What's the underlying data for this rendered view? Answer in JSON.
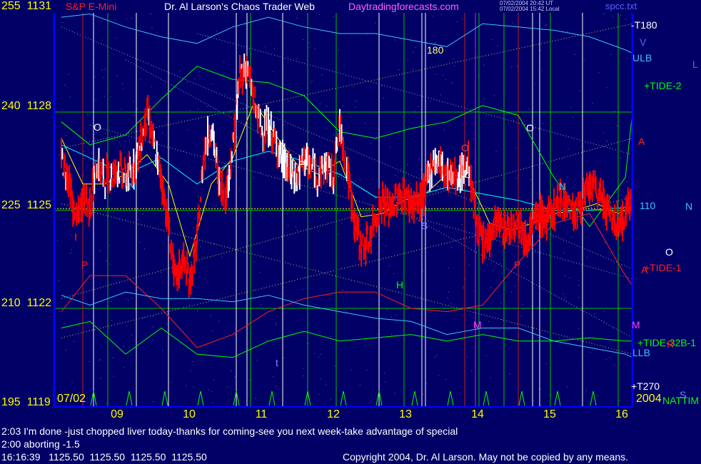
{
  "header": {
    "instrument": "S&P E-Mini",
    "title": "Dr. Al Larson's Chaos Trader Web",
    "site": "Daytradingforecasts.com",
    "timestamp_1": "07/02/2004 20:42 UT",
    "timestamp_2": "07/02/2004 15:42 Local",
    "file": "spcc.txt"
  },
  "start_date": "07/02",
  "year": "2004",
  "right_labels": {
    "t180": "-T180",
    "ulb": "ULB",
    "tide2": "+TIDE-2",
    "p110": "110",
    "tide1": "+TIDE-1",
    "tide32": "+TIDE-32B-1",
    "llb": "LLB",
    "t270": "+T270",
    "natim": "NATTIM"
  },
  "markers": {
    "o": "O",
    "n": "N",
    "p": "P",
    "s": "S",
    "h": "H",
    "m": "M",
    "t": "t",
    "a": "A",
    "v": "V",
    "l": "L",
    "r": "R",
    "deg180": "180"
  },
  "messages": [
    "2:03 I'm done -just chopped liver today-thanks for coming-see you next week-take advantage of special",
    "2:00 aborting -1.5"
  ],
  "last_quote": "16:16:39   1125.50  1125.50  1125.50  1125.50",
  "copyright": "Copyright 2004, Dr. Al Larson. May not be copied by any means.",
  "colors": {
    "background": "#000066",
    "grid_green": "#00c000",
    "axis_blue": "#0000ff",
    "bar_up": "#ffffff",
    "bar_down": "#ff0000",
    "ma_fast": "#ffff00",
    "ma_slow": "#00ffff",
    "tide_green": "#00ff00",
    "tide_red": "#ff2020",
    "band_cyan": "#40c0ff"
  },
  "chart_data": {
    "type": "line",
    "title": "S&P E-Mini",
    "xlabel": "",
    "ylabel": "",
    "y_ticks": [
      {
        "left": "255",
        "right": "1131",
        "value": 1131
      },
      {
        "left": "240",
        "right": "1128",
        "value": 1128
      },
      {
        "left": "225",
        "right": "1125",
        "value": 1125
      },
      {
        "left": "210",
        "right": "1122",
        "value": 1122
      },
      {
        "left": "195",
        "right": "1119",
        "value": 1119
      }
    ],
    "x_ticks": [
      "09",
      "10",
      "11",
      "12",
      "13",
      "14",
      "15",
      "16"
    ],
    "ylim": [
      1119,
      1131.5
    ],
    "xlim": [
      8.0,
      16.1
    ],
    "grid": true,
    "series": [
      {
        "name": "S&P E-Mini",
        "x": [
          8.1,
          8.2,
          8.3,
          8.4,
          8.5,
          8.6,
          8.7,
          8.8,
          8.9,
          9.0,
          9.1,
          9.2,
          9.3,
          9.4,
          9.5,
          9.6,
          9.7,
          9.8,
          9.9,
          10.0,
          10.1,
          10.2,
          10.3,
          10.4,
          10.5,
          10.6,
          10.7,
          10.8,
          10.9,
          11.0,
          11.1,
          11.2,
          11.3,
          11.4,
          11.5,
          11.6,
          11.7,
          11.8,
          11.9,
          12.0,
          12.1,
          12.2,
          12.3,
          12.4,
          12.5,
          12.6,
          12.7,
          12.8,
          12.9,
          13.0,
          13.1,
          13.2,
          13.3,
          13.4,
          13.5,
          13.6,
          13.7,
          13.8,
          13.9,
          14.0,
          14.1,
          14.2,
          14.3,
          14.4,
          14.5,
          14.6,
          14.7,
          14.8,
          14.9,
          15.0,
          15.1,
          15.2,
          15.3,
          15.4,
          15.5,
          15.6,
          15.7,
          15.8,
          15.9,
          16.0,
          16.1
        ],
        "values": [
          1126.6,
          1126.0,
          1124.5,
          1125.4,
          1125.1,
          1126.4,
          1126.0,
          1126.1,
          1126.3,
          1126.0,
          1126.2,
          1126.9,
          1128.0,
          1127.0,
          1126.0,
          1124.5,
          1122.8,
          1123.5,
          1122.8,
          1124.0,
          1126.8,
          1127.6,
          1126.0,
          1125.4,
          1126.9,
          1129.1,
          1129.4,
          1128.3,
          1127.5,
          1127.5,
          1127.1,
          1126.5,
          1126.1,
          1126.0,
          1126.6,
          1126.3,
          1126.1,
          1126.4,
          1126.0,
          1127.6,
          1126.3,
          1124.7,
          1123.9,
          1124.0,
          1124.8,
          1125.3,
          1125.0,
          1125.4,
          1125.5,
          1125.2,
          1125.2,
          1125.6,
          1126.5,
          1126.5,
          1126.1,
          1126.0,
          1126.1,
          1126.5,
          1124.8,
          1123.9,
          1124.2,
          1124.7,
          1124.4,
          1124.5,
          1124.8,
          1124.1,
          1124.5,
          1124.9,
          1124.7,
          1125.0,
          1125.4,
          1125.2,
          1124.9,
          1125.3,
          1125.7,
          1125.6,
          1125.3,
          1124.7,
          1124.6,
          1124.8,
          1125.5
        ]
      },
      {
        "name": "",
        "x": [
          8.1,
          8.4,
          8.7,
          9.0,
          9.3,
          9.6,
          9.9,
          10.2,
          10.5,
          10.8,
          11.1,
          11.4,
          11.7,
          12.0,
          12.3,
          12.6,
          12.9,
          13.2,
          13.5,
          13.8,
          14.1,
          14.4,
          14.7,
          15.0,
          15.3,
          15.6,
          15.9,
          16.1
        ],
        "values": [
          1127.2,
          1125.8,
          1125.8,
          1126.1,
          1126.7,
          1125.8,
          1123.6,
          1125.8,
          1126.6,
          1128.3,
          1127.3,
          1126.4,
          1126.1,
          1126.5,
          1124.8,
          1124.9,
          1125.3,
          1125.5,
          1126.1,
          1126.0,
          1124.6,
          1124.4,
          1124.6,
          1124.9,
          1125.0,
          1125.2,
          1124.9,
          1125.1
        ]
      },
      {
        "name": "",
        "x": [
          8.1,
          8.5,
          9.0,
          9.5,
          10.0,
          10.5,
          11.0,
          11.5,
          12.0,
          12.5,
          13.0,
          13.5,
          14.0,
          14.5,
          15.0,
          15.5,
          16.1
        ],
        "values": [
          1127.0,
          1126.6,
          1126.1,
          1126.6,
          1125.8,
          1126.5,
          1126.8,
          1126.5,
          1126.1,
          1125.4,
          1125.4,
          1125.7,
          1125.5,
          1125.3,
          1125.0,
          1125.0,
          1125.1
        ]
      },
      {
        "name": "+TIDE-2",
        "x": [
          8.1,
          8.5,
          9.0,
          9.5,
          10.0,
          10.5,
          11.0,
          11.5,
          12.0,
          12.5,
          13.0,
          13.5,
          14.0,
          14.5,
          15.0,
          15.5,
          16.0,
          16.1
        ],
        "values": [
          1127.7,
          1127.0,
          1127.3,
          1128.4,
          1129.4,
          1129.0,
          1128.9,
          1128.5,
          1127.4,
          1127.2,
          1127.5,
          1127.7,
          1128.2,
          1127.9,
          1126.0,
          1124.5,
          1126.0,
          1128.0
        ]
      },
      {
        "name": "+TIDE-1",
        "x": [
          8.1,
          8.5,
          9.0,
          9.5,
          10.0,
          10.5,
          11.0,
          11.5,
          12.0,
          12.5,
          13.0,
          13.5,
          14.0,
          14.5,
          15.0,
          15.5,
          16.0,
          16.1
        ],
        "values": [
          1121.9,
          1123.0,
          1123.0,
          1122.0,
          1120.8,
          1121.2,
          1121.9,
          1122.3,
          1122.5,
          1122.5,
          1122.0,
          1121.9,
          1122.1,
          1123.4,
          1124.6,
          1124.9,
          1123.0,
          1122.7
        ]
      },
      {
        "name": "ULB",
        "x": [
          8.1,
          8.5,
          9.0,
          9.5,
          10.0,
          10.5,
          11.0,
          11.5,
          12.0,
          12.5,
          13.0,
          13.5,
          14.0,
          14.5,
          15.0,
          15.5,
          16.0,
          16.1
        ],
        "values": [
          1130.9,
          1131.0,
          1130.6,
          1130.3,
          1130.1,
          1130.6,
          1130.9,
          1130.6,
          1130.4,
          1130.4,
          1130.2,
          1130.0,
          1130.7,
          1130.6,
          1130.5,
          1130.3,
          1129.9,
          1129.8
        ]
      },
      {
        "name": "LLB",
        "x": [
          8.1,
          8.5,
          9.0,
          9.5,
          10.0,
          10.5,
          11.0,
          11.5,
          12.0,
          12.5,
          13.0,
          13.5,
          14.0,
          14.5,
          15.0,
          15.5,
          16.0,
          16.1
        ],
        "values": [
          1122.4,
          1122.1,
          1122.5,
          1122.3,
          1122.3,
          1122.2,
          1122.4,
          1122.1,
          1121.9,
          1121.7,
          1121.6,
          1121.2,
          1121.4,
          1121.4,
          1121.0,
          1120.8,
          1120.6,
          1120.5
        ]
      },
      {
        "name": "+TIDE-32B-1",
        "x": [
          8.1,
          8.5,
          9.0,
          9.5,
          10.0,
          10.5,
          11.0,
          11.5,
          12.0,
          12.5,
          13.0,
          13.5,
          14.0,
          14.5,
          15.0,
          15.5,
          16.0,
          16.1
        ],
        "values": [
          1121.4,
          1121.6,
          1120.6,
          1121.4,
          1120.6,
          1120.5,
          1121.0,
          1121.3,
          1121.0,
          1121.1,
          1121.2,
          1121.0,
          1121.2,
          1121.0,
          1121.0,
          1121.1,
          1121.0,
          1121.0
        ]
      }
    ],
    "vertical_lines": {
      "green": [
        8.75,
        9.6,
        10.75,
        11.55,
        11.95,
        12.9,
        13.95,
        14.3,
        14.95,
        15.9
      ],
      "white": [
        8.55,
        9.15,
        9.6,
        10.55,
        10.7,
        11.2,
        12.55,
        13.15,
        13.2,
        14.7,
        14.8,
        15.4
      ],
      "red": [
        8.4,
        13.75,
        14.5
      ],
      "magenta": [
        13.9
      ]
    },
    "horizontal_lines": [
      1128,
      1125,
      1122
    ]
  }
}
